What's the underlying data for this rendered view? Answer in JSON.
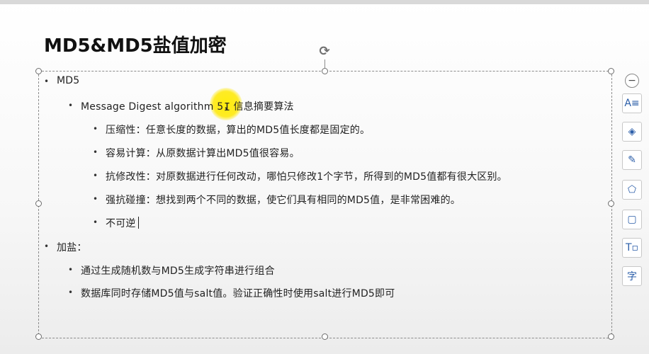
{
  "slide": {
    "title": "MD5&MD5盐值加密",
    "bullets": [
      {
        "level": 1,
        "text": "MD5"
      },
      {
        "level": 2,
        "text": "Message Digest algorithm 5，信息摘要算法"
      },
      {
        "level": 3,
        "text": "压缩性：任意长度的数据，算出的MD5值长度都是固定的。"
      },
      {
        "level": 3,
        "text": "容易计算：从原数据计算出MD5值很容易。"
      },
      {
        "level": 3,
        "text": "抗修改性：对原数据进行任何改动，哪怕只修改1个字节，所得到的MD5值都有很大区别。"
      },
      {
        "level": 3,
        "text": "强抗碰撞：想找到两个不同的数据，使它们具有相同的MD5值，是非常困难的。"
      },
      {
        "level": 3,
        "text": "不可逆"
      },
      {
        "level": 1,
        "text": "加盐："
      },
      {
        "level": 2,
        "text": "通过生成随机数与MD5生成字符串进行组合"
      },
      {
        "level": 2,
        "text": "数据库同时存储MD5值与salt值。验证正确性时使用salt进行MD5即可"
      }
    ]
  },
  "toolbar": {
    "collapse": "−",
    "items": [
      {
        "name": "text-style-icon",
        "glyph": "A≡"
      },
      {
        "name": "layers-icon",
        "glyph": "◈"
      },
      {
        "name": "brush-icon",
        "glyph": "✎"
      },
      {
        "name": "shape-fill-icon",
        "glyph": "⬠"
      },
      {
        "name": "frame-icon",
        "glyph": "▢"
      },
      {
        "name": "text-box-icon",
        "glyph": "T▫"
      },
      {
        "name": "font-icon",
        "glyph": "字"
      }
    ]
  }
}
